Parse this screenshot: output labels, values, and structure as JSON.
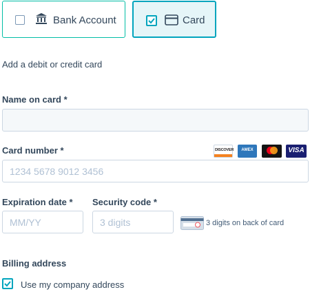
{
  "payment_methods": {
    "bank_label": "Bank Account",
    "card_label": "Card"
  },
  "helper_text": "Add a debit or credit card",
  "name_on_card": {
    "label": "Name on card *",
    "value": ""
  },
  "card_number": {
    "label": "Card number *",
    "placeholder": "1234 5678 9012 3456"
  },
  "card_brands": [
    "DISCOVER",
    "AMEX",
    "mastercard",
    "VISA"
  ],
  "expiration": {
    "label": "Expiration date *",
    "placeholder": "MM/YY"
  },
  "security": {
    "label": "Security code *",
    "placeholder": "3 digits",
    "hint": "3 digits on back of card"
  },
  "billing": {
    "label": "Billing address",
    "use_company_label": "Use my company address",
    "use_company_checked": true
  },
  "colors": {
    "accent": "#00a4bd",
    "accent_border": "#00bda5",
    "text": "#33475b"
  }
}
